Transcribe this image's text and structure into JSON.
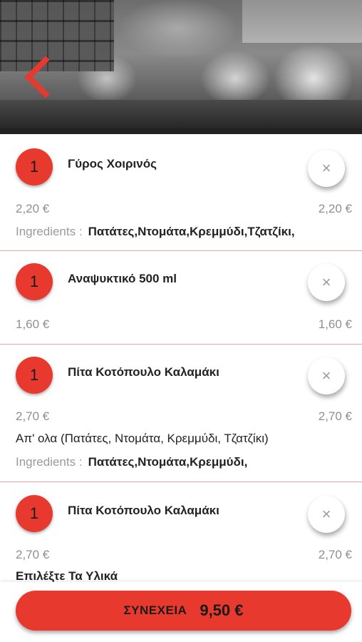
{
  "header": {
    "back_icon": "chevron-left-icon",
    "accent": "#e8392f"
  },
  "cart": {
    "items": [
      {
        "qty": "1",
        "name": "Γύρος Χοιρινός",
        "price_left": "2,20 €",
        "price_right": "2,20 €",
        "ingredients_label": "Ingredients :",
        "ingredients": "Πατάτες,Ντομάτα,Κρεμμύδι,Τζατζίκι,"
      },
      {
        "qty": "1",
        "name": "Αναψυκτικό 500 ml",
        "price_left": "1,60 €",
        "price_right": "1,60 €"
      },
      {
        "qty": "1",
        "name": "Πίτα Κοτόπουλο Καλαμάκι",
        "price_left": "2,70 €",
        "price_right": "2,70 €",
        "option": "Απ' ολα (Πατάτες, Ντομάτα, Κρεμμύδι, Τζατζίκι)",
        "ingredients_label": "Ingredients :",
        "ingredients": "Πατάτες,Ντομάτα,Κρεμμύδι,"
      },
      {
        "qty": "1",
        "name": "Πίτα Κοτόπουλο Καλαμάκι",
        "price_left": "2,70 €",
        "price_right": "2,70 €",
        "option": "Επιλέξτε Τα Υλικά"
      }
    ],
    "remove_symbol": "×"
  },
  "footer": {
    "continue_label": "ΣΥΝΕΧΕΙΑ",
    "total": "9,50 €"
  }
}
